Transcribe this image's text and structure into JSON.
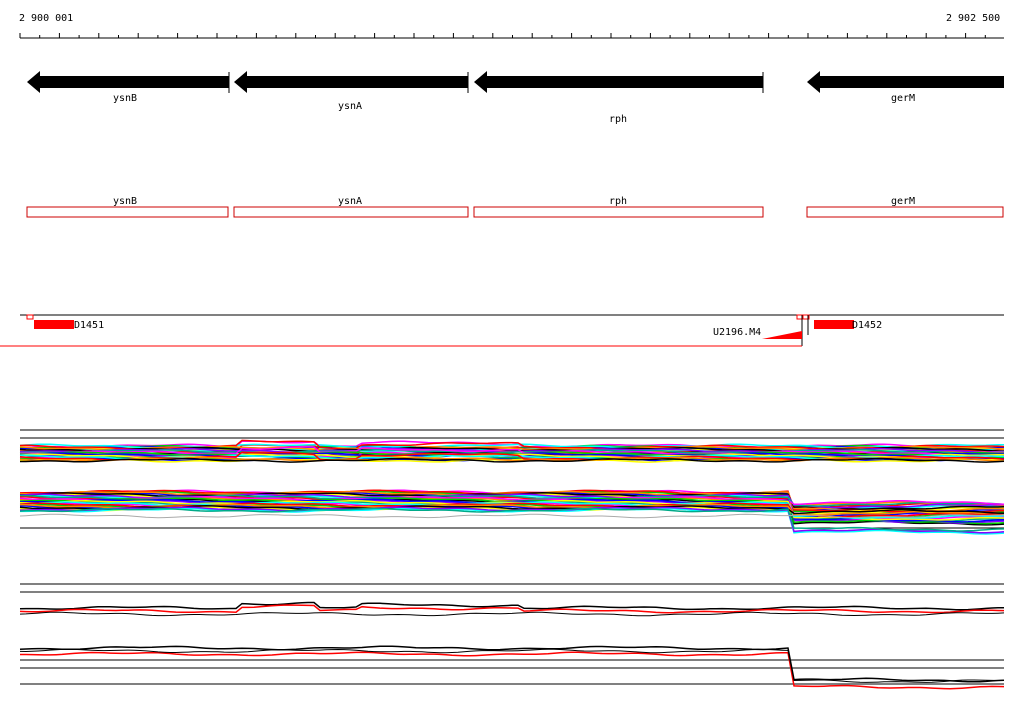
{
  "ruler": {
    "start_label": "2 900 001",
    "end_label": "2 902 500"
  },
  "genes": [
    {
      "name": "ysnB"
    },
    {
      "name": "ysnA"
    },
    {
      "name": "rph"
    },
    {
      "name": "gerM"
    }
  ],
  "features": [
    {
      "label": "D1451"
    },
    {
      "label": "U2196.M4"
    },
    {
      "label": "D1452"
    }
  ],
  "colors": {
    "gene_arrow": "#000000",
    "annotation_box": "#cc0000",
    "feature_fill": "#ff0000",
    "axis": "#000000",
    "trace_palette": [
      "#ff00ff",
      "#00cc00",
      "#0000ff",
      "#ffff00",
      "#00ffff",
      "#ff0000",
      "#ff8800",
      "#000000",
      "#8800ff",
      "#00aa88"
    ]
  }
}
